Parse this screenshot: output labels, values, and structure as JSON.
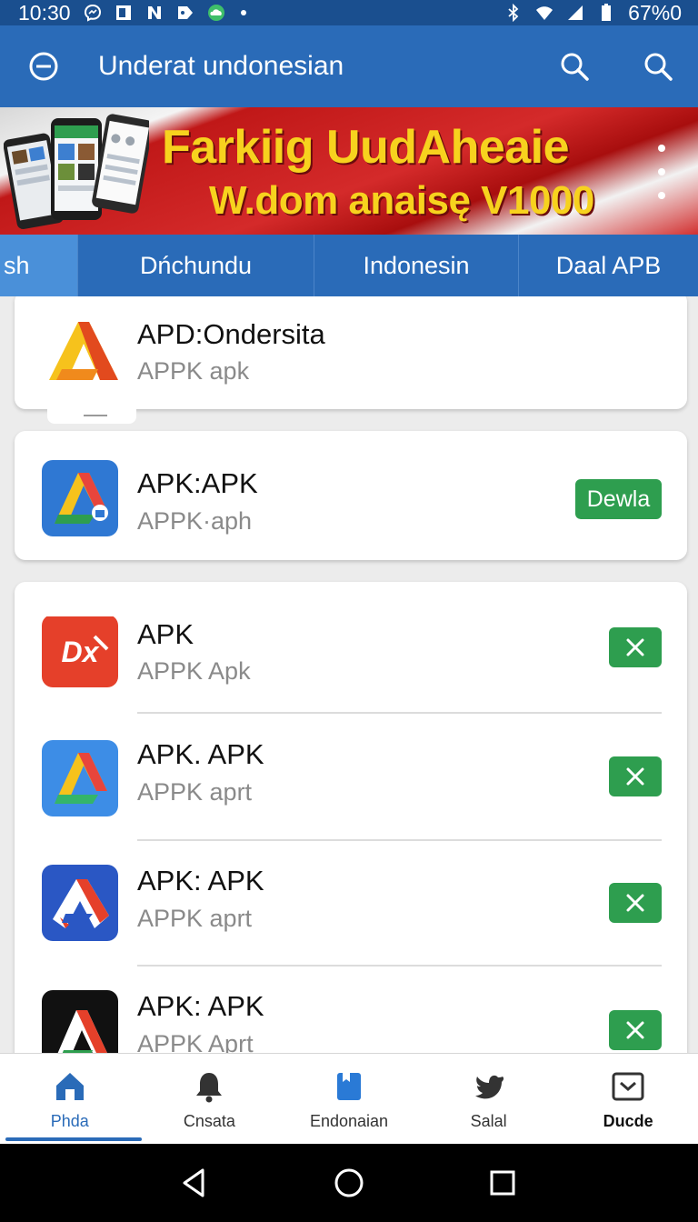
{
  "status_bar": {
    "time": "10:30",
    "battery": "67%0",
    "left_icons": [
      "messenger-icon",
      "news-icon",
      "n-icon",
      "tag-icon",
      "cloud-icon",
      "dot-icon"
    ],
    "right_icons": [
      "bluetooth-icon",
      "wifi-icon",
      "signal-icon",
      "battery-icon"
    ]
  },
  "app_bar": {
    "title": "Underat undonesian",
    "menu_icon": "minus-circle-icon",
    "actions": [
      "search-icon",
      "search-icon"
    ]
  },
  "banner": {
    "line1": "Farkiig UudAheaie",
    "line2": "W.dom anaisę V1000",
    "colors": {
      "background": "#c41c1c",
      "text": "#f7d21e"
    }
  },
  "tabs": [
    {
      "label": "sh",
      "active": true
    },
    {
      "label": "Dńchundu",
      "active": false
    },
    {
      "label": "Indonesin",
      "active": false
    },
    {
      "label": "Daal APB",
      "active": false
    }
  ],
  "apps": [
    {
      "name": "APD:Ondersita",
      "sub": "APPK  apk",
      "icon": "yellow-red-a-icon"
    },
    {
      "name": "APK:APK",
      "sub": "APPK·aph",
      "icon": "blue-a-icon",
      "action": "Dewla"
    },
    {
      "name": "APK",
      "sub": "APPK  Apk",
      "icon": "red-dx-icon",
      "action": "remove"
    },
    {
      "name": "APK. APK",
      "sub": "APPK  aprt",
      "icon": "blue-a-icon",
      "action": "remove"
    },
    {
      "name": "APK: APK",
      "sub": "APPK  aprt",
      "icon": "blue-red-a-icon",
      "action": "remove"
    },
    {
      "name": "APK: APK",
      "sub": "APPK  Aprt",
      "icon": "black-a-icon",
      "action": "remove"
    }
  ],
  "bottom_nav": [
    {
      "label": "Phda",
      "icon": "home-icon",
      "active": true
    },
    {
      "label": "Cnsata",
      "icon": "bell-icon",
      "active": false
    },
    {
      "label": "Endonaian",
      "icon": "book-icon",
      "active": false
    },
    {
      "label": "Salal",
      "icon": "bird-icon",
      "active": false
    },
    {
      "label": "Ducde",
      "icon": "inbox-icon",
      "active": false
    }
  ],
  "colors": {
    "primary": "#2a6bb8",
    "status_bar": "#1a4f8f",
    "accent_green": "#2e9e4f",
    "background": "#ececec"
  }
}
